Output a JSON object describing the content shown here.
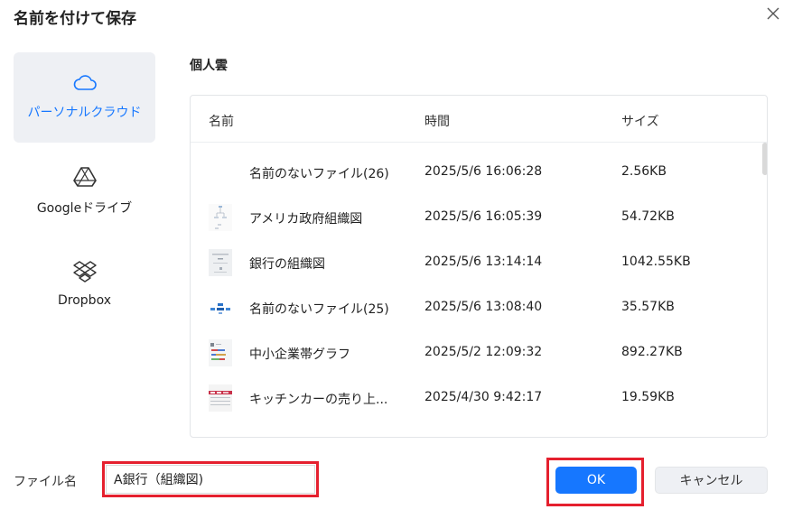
{
  "dialog": {
    "title": "名前を付けて保存",
    "close_icon": "close-icon"
  },
  "sidebar": {
    "items": [
      {
        "label": "パーソナルクラウド",
        "icon": "cloud-icon",
        "active": true
      },
      {
        "label": "Googleドライブ",
        "icon": "google-drive-icon",
        "active": false
      },
      {
        "label": "Dropbox",
        "icon": "dropbox-icon",
        "active": false
      }
    ]
  },
  "location": {
    "title": "個人雲"
  },
  "file_list": {
    "columns": [
      "名前",
      "時間",
      "サイズ"
    ],
    "rows": [
      {
        "name": "名前のないファイル(26)",
        "time": "2025/5/6 16:06:28",
        "size": "2.56KB"
      },
      {
        "name": "アメリカ政府組織図",
        "time": "2025/5/6 16:05:39",
        "size": "54.72KB"
      },
      {
        "name": "銀行の組織図",
        "time": "2025/5/6 13:14:14",
        "size": "1042.55KB"
      },
      {
        "name": "名前のないファイル(25)",
        "time": "2025/5/6 13:08:40",
        "size": "35.57KB"
      },
      {
        "name": "中小企業帯グラフ",
        "time": "2025/5/2 12:09:32",
        "size": "892.27KB"
      },
      {
        "name": "キッチンカーの売り上...",
        "time": "2025/4/30 9:42:17",
        "size": "19.59KB"
      }
    ]
  },
  "footer": {
    "filename_label": "ファイル名",
    "filename_value": "A銀行（組織図)",
    "ok_label": "OK",
    "cancel_label": "キャンセル"
  },
  "colors": {
    "accent": "#1677ff",
    "highlight_frame": "#e5202e",
    "sidebar_active_bg": "#eef0f4"
  }
}
